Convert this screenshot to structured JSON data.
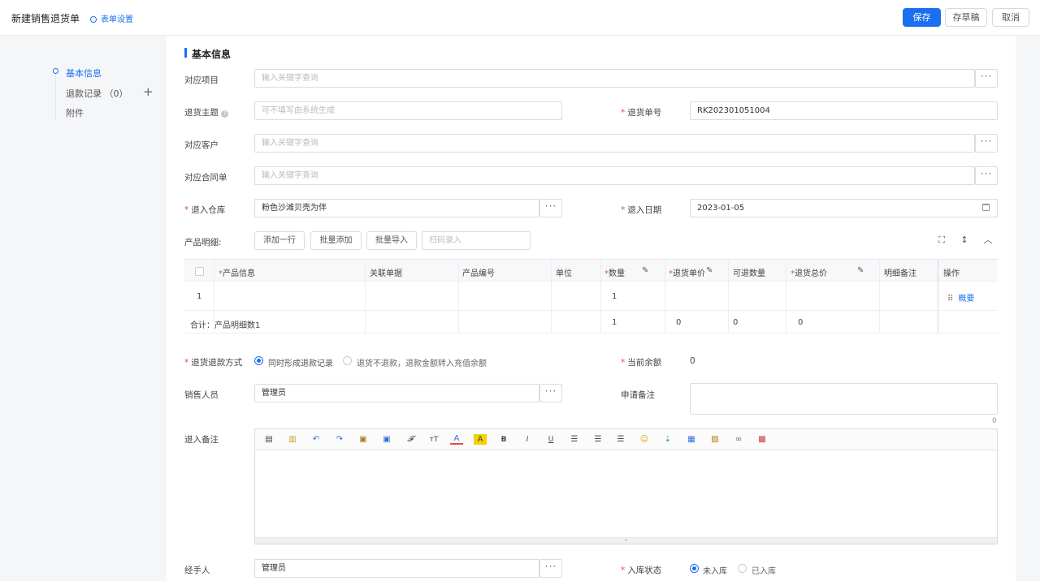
{
  "header": {
    "title": "新建销售退货单",
    "form_settings": "表单设置",
    "save": "保存",
    "draft": "存草稿",
    "cancel": "取消"
  },
  "sidebar": {
    "items": [
      {
        "label": "基本信息"
      },
      {
        "label": "退款记录 （0）"
      },
      {
        "label": "附件"
      }
    ]
  },
  "section": {
    "title": "基本信息"
  },
  "form": {
    "project": {
      "label": "对应项目",
      "placeholder": "输入关键字查询"
    },
    "subject": {
      "label": "退货主题",
      "placeholder": "可不填写由系统生成"
    },
    "return_no": {
      "label": "退货单号",
      "value": "RK202301051004"
    },
    "customer": {
      "label": "对应客户",
      "placeholder": "输入关键字查询"
    },
    "contract": {
      "label": "对应合同单",
      "placeholder": "输入关键字查询"
    },
    "warehouse": {
      "label": "退入仓库",
      "value": "粉色沙滩贝壳为伴"
    },
    "return_date": {
      "label": "退入日期",
      "value": "2023-01-05"
    },
    "product_detail": {
      "label": "产品明细:"
    },
    "buttons": {
      "add_row": "添加一行",
      "batch_add": "批量添加",
      "batch_import": "批量导入",
      "scan_placeholder": "扫码录入"
    },
    "refund_method": {
      "label": "退货退款方式",
      "opt1": "同时形成退款记录",
      "opt2": "退货不退款，退款金额转入充值余额"
    },
    "balance": {
      "label": "当前余额",
      "value": "0"
    },
    "salesperson": {
      "label": "销售人员",
      "value": "管理员"
    },
    "apply_note": {
      "label": "申请备注",
      "counter": "0"
    },
    "in_note": {
      "label": "退入备注"
    },
    "handler": {
      "label": "经手人",
      "value": "管理员"
    },
    "stock_status": {
      "label": "入库状态",
      "opt1": "未入库",
      "opt2": "已入库"
    }
  },
  "table": {
    "headers": {
      "product": "产品信息",
      "related": "关联单据",
      "code": "产品编号",
      "unit": "单位",
      "qty": "数量",
      "price": "退货单价",
      "returnable": "可退数量",
      "total": "退货总价",
      "remark": "明细备注",
      "op": "操作"
    },
    "row1": {
      "index": "1",
      "qty": "1",
      "op": "概要"
    },
    "summary": {
      "label": "合计：产品明细数1",
      "qty": "1",
      "price": "0",
      "returnable": "0",
      "total": "0"
    }
  },
  "editor": {
    "tools": [
      "源码",
      "新建",
      "撤销",
      "重做",
      "粘贴",
      "粘贴文本",
      "清除格式",
      "字号",
      "字体颜色",
      "背景色",
      "B",
      "I",
      "U",
      "左对齐",
      "居中",
      "右对齐",
      "表情",
      "插入",
      "表格",
      "图片",
      "链接",
      "其他"
    ]
  }
}
